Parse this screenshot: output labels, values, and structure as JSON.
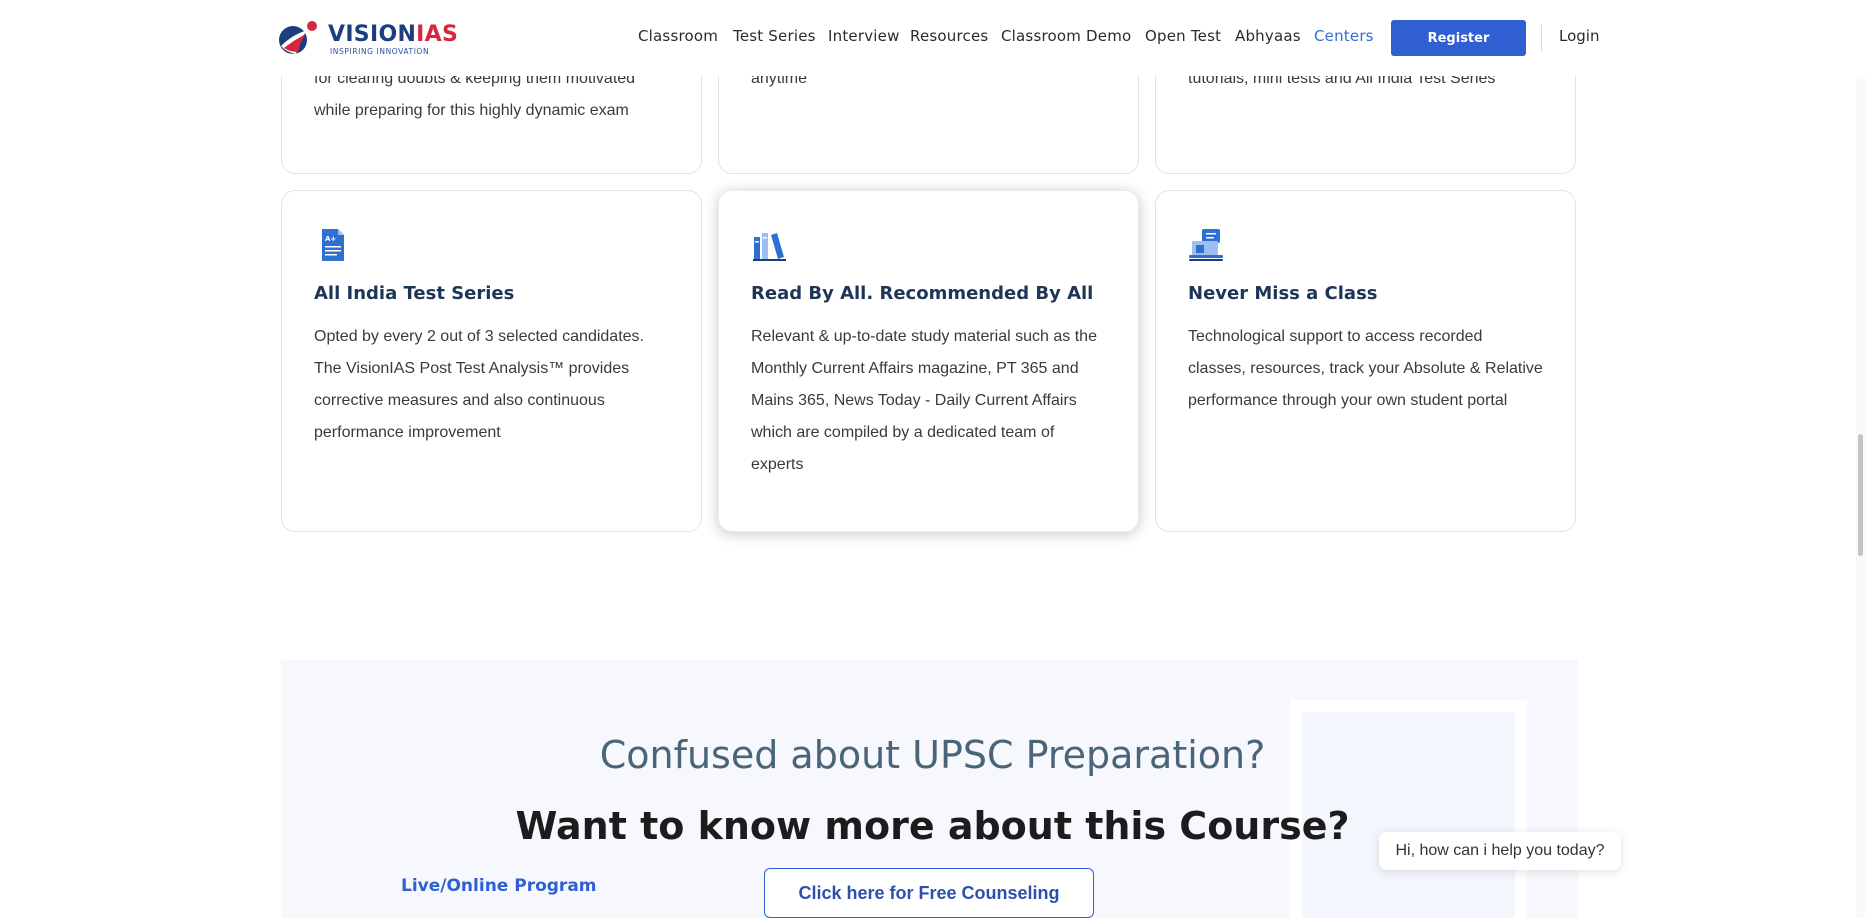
{
  "header": {
    "logo": {
      "word1": "VISION",
      "word2": "IAS",
      "tagline": "INSPIRING INNOVATION"
    },
    "nav": [
      {
        "label": "Classroom"
      },
      {
        "label": "Test Series"
      },
      {
        "label": "Interview"
      },
      {
        "label": "Resources"
      },
      {
        "label": "Classroom Demo"
      },
      {
        "label": "Open Test"
      },
      {
        "label": "Abhyaas"
      },
      {
        "label": "Centers",
        "active": true
      }
    ],
    "register_label": "Register",
    "login_label": "Login"
  },
  "cards_top": [
    {
      "lines": [
        "for clearing doubts & keeping them motivated",
        "while preparing for this highly dynamic exam"
      ]
    },
    {
      "lines": [
        "anytime"
      ]
    },
    {
      "lines": [
        "tutorials, mini tests and All India Test Series"
      ]
    }
  ],
  "cards": [
    {
      "icon": "test-document-icon",
      "title": "All India Test Series",
      "lines": [
        "Opted by every 2 out of 3 selected candidates.",
        "The VisionIAS Post Test Analysis™ provides",
        "corrective measures and also continuous",
        "performance improvement"
      ]
    },
    {
      "icon": "books-icon",
      "title": "Read By All. Recommended By All",
      "lines": [
        "Relevant & up-to-date study material such as the",
        "Monthly Current Affairs magazine, PT 365 and",
        "Mains 365, News Today - Daily Current Affairs",
        "which are compiled by a dedicated team of",
        "experts"
      ]
    },
    {
      "icon": "laptop-class-icon",
      "title": "Never Miss a Class",
      "lines": [
        "Technological support to access recorded",
        "classes, resources, track your Absolute & Relative",
        "performance through your own student portal"
      ]
    }
  ],
  "counseling": {
    "heading": "Confused about UPSC Preparation?",
    "subheading": "Want to know more about this Course?",
    "program_label": "Live/Online Program",
    "button_label": "Click here for Free Counseling"
  },
  "chat": {
    "prompt": "Hi, how can i help you today?"
  },
  "colors": {
    "brand_blue": "#2f5fd0",
    "brand_red": "#d7263d",
    "title_navy": "#1d3557"
  }
}
